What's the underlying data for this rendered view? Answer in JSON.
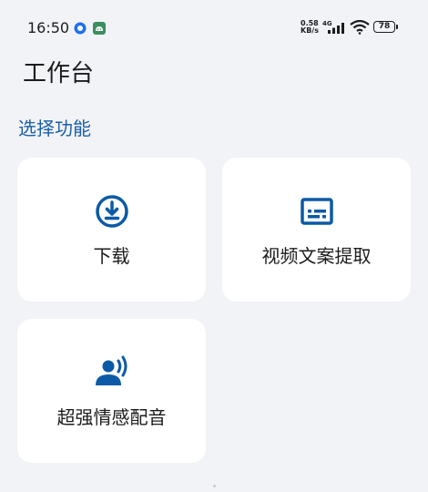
{
  "status_bar": {
    "time": "16:50",
    "net_speed_value": "0.58",
    "net_speed_unit": "KB/s",
    "network_type": "4G",
    "battery_level": "78"
  },
  "header": {
    "title": "工作台"
  },
  "section": {
    "label": "选择功能"
  },
  "features": [
    {
      "label": "下载",
      "icon": "download-icon"
    },
    {
      "label": "视频文案提取",
      "icon": "subtitles-icon"
    },
    {
      "label": "超强情感配音",
      "icon": "voice-icon"
    }
  ],
  "colors": {
    "accent": "#1a5fa8",
    "icon_blue": "#0b5aa6",
    "background": "#f2f3f7",
    "card": "#ffffff"
  }
}
